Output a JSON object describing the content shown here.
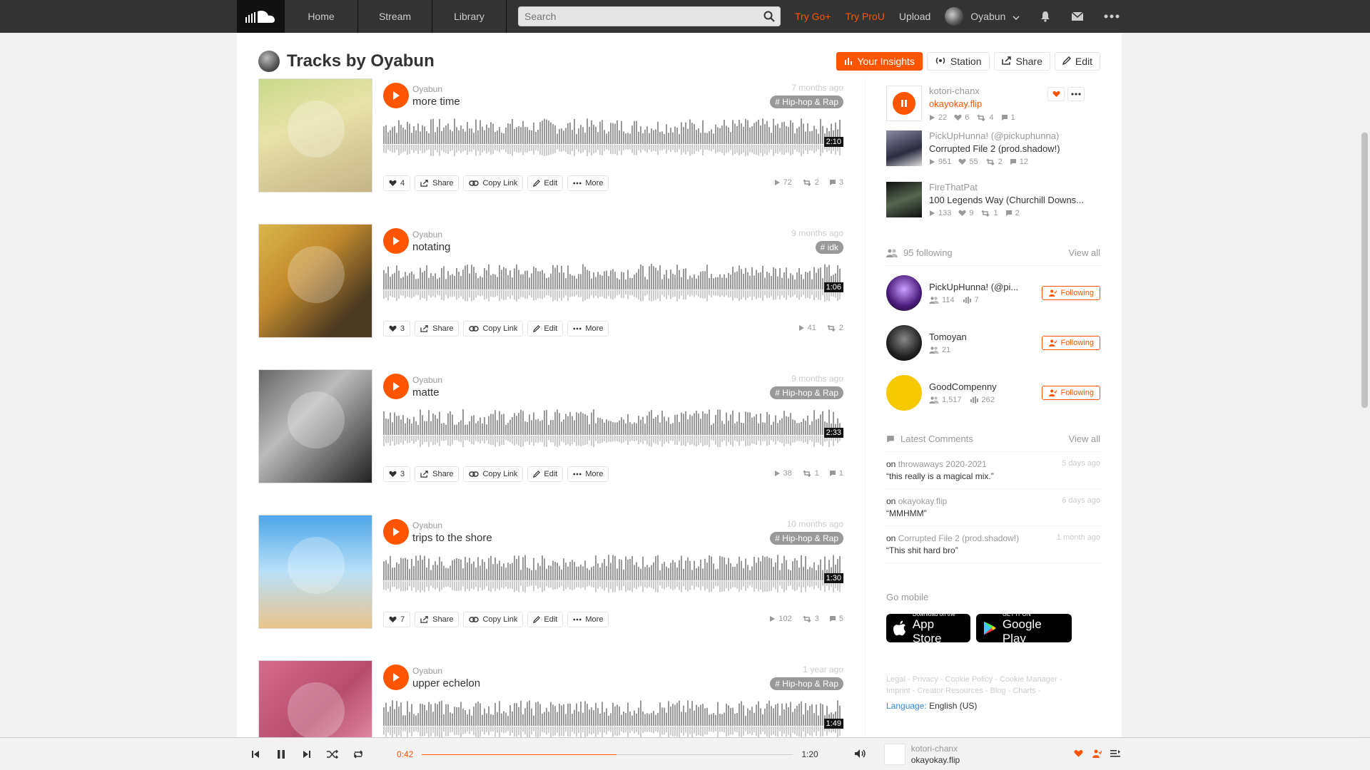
{
  "header": {
    "nav": {
      "home": "Home",
      "stream": "Stream",
      "library": "Library"
    },
    "search_placeholder": "Search",
    "try_go": "Try Go+",
    "try_pro": "Try ProU",
    "upload": "Upload",
    "username": "Oyabun"
  },
  "profile": {
    "title": "Tracks by Oyabun",
    "actions": {
      "insights": "Your Insights",
      "station": "Station",
      "share": "Share",
      "edit": "Edit"
    }
  },
  "tracks": [
    {
      "user": "Oyabun",
      "title": "more time",
      "time": "7 months ago",
      "tag": "# Hip-hop & Rap",
      "duration": "2:10",
      "likes": "4",
      "plays": "72",
      "reposts": "2",
      "comments": "3"
    },
    {
      "user": "Oyabun",
      "title": "notating",
      "time": "9 months ago",
      "tag": "# idk",
      "duration": "1:06",
      "likes": "3",
      "plays": "41",
      "reposts": "2",
      "comments": ""
    },
    {
      "user": "Oyabun",
      "title": "matte",
      "time": "9 months ago",
      "tag": "# Hip-hop & Rap",
      "duration": "2:33",
      "likes": "3",
      "plays": "38",
      "reposts": "1",
      "comments": "1"
    },
    {
      "user": "Oyabun",
      "title": "trips to the shore",
      "time": "10 months ago",
      "tag": "# Hip-hop & Rap",
      "duration": "1:30",
      "likes": "7",
      "plays": "102",
      "reposts": "3",
      "comments": "5"
    },
    {
      "user": "Oyabun",
      "title": "upper echelon",
      "time": "1 year ago",
      "tag": "# Hip-hop & Rap",
      "duration": "1:49",
      "likes": "",
      "plays": "",
      "reposts": "",
      "comments": ""
    }
  ],
  "track_actions": {
    "share": "Share",
    "copy_link": "Copy Link",
    "edit": "Edit",
    "more": "More"
  },
  "sidebar": {
    "now_playing": {
      "user": "kotori-chanx",
      "title": "okayokay.flip",
      "plays": "22",
      "likes": "6",
      "reposts": "4",
      "comments": "1"
    },
    "related": [
      {
        "user": "PickUpHunna! (@pickuphunna)",
        "title": "Corrupted File 2 (prod.shadow!)",
        "plays": "951",
        "likes": "55",
        "reposts": "2",
        "comments": "12"
      },
      {
        "user": "FireThatPat",
        "title": "100 Legends Way (Churchill Downs...",
        "plays": "133",
        "likes": "9",
        "reposts": "1",
        "comments": "2"
      }
    ],
    "following": {
      "label": "95 following",
      "view_all": "View all",
      "items": [
        {
          "name": "PickUpHunna! (@pi...",
          "followers": "114",
          "tracks": "7",
          "button": "Following"
        },
        {
          "name": "Tomoyan",
          "followers": "21",
          "tracks": "",
          "button": "Following"
        },
        {
          "name": "GoodCompenny",
          "followers": "1,517",
          "tracks": "262",
          "button": "Following"
        }
      ]
    },
    "comments": {
      "label": "Latest Comments",
      "view_all": "View all",
      "items": [
        {
          "on": "on",
          "track": "throwaways 2020-2021",
          "text": "“this really is a magical mix.”",
          "time": "5 days ago"
        },
        {
          "on": "on",
          "track": "okayokay.flip",
          "text": "“MMHMM”",
          "time": "6 days ago"
        },
        {
          "on": "on",
          "track": "Corrupted File 2 (prod.shadow!)",
          "text": "“This shit hard bro”",
          "time": "1 month ago"
        }
      ]
    },
    "go_mobile": "Go mobile",
    "app_store": {
      "small": "Download on the",
      "big": "App Store"
    },
    "google_play": {
      "small": "GET IT ON",
      "big": "Google Play"
    },
    "legal_line1": "Legal - Privacy - Cookie Policy - Cookie Manager -",
    "legal_line2": "Imprint - Creator Resources - Blog - Charts -",
    "language_label": "Language:",
    "language_value": "English (US)"
  },
  "player": {
    "elapsed": "0:42",
    "duration": "1:20",
    "progress_fraction": 0.525,
    "user": "kotori-chanx",
    "title": "okayokay.flip"
  },
  "colors": {
    "accent": "#ff5500",
    "header_bg": "#333333"
  }
}
